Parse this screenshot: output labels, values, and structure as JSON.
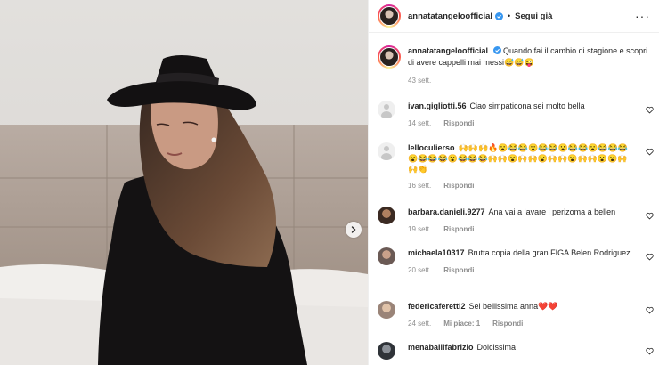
{
  "post": {
    "username": "annatatangeloofficial",
    "follow_label": "Segui già",
    "dot": "•",
    "more": "···",
    "caption": "Quando fai il cambio di stagione e scopri di avere cappelli mai messi😅😅😜",
    "caption_time": "43 sett."
  },
  "comments": [
    {
      "user": "ivan.gigliotti.56",
      "text": "Ciao simpaticona sei molto bella",
      "time": "14 sett.",
      "reply": "Rispondi",
      "likes": ""
    },
    {
      "user": "lelloculierso",
      "text": "🙌🙌🙌🔥😮😂😂😮😂😂😮😂😂😮😂😂😂😮😂😂😂😮😂😂😂🙌🙌😮🙌🙌😮🙌🙌😮🙌🙌😮😮🙌🙌👏",
      "time": "16 sett.",
      "reply": "Rispondi",
      "likes": ""
    },
    {
      "user": "barbara.danieli.9277",
      "text": "Ana vai a lavare i perizoma a bellen",
      "time": "19 sett.",
      "reply": "Rispondi",
      "likes": ""
    },
    {
      "user": "michaela10317",
      "text": "Brutta copia della gran FIGA Belen Rodriguez",
      "time": "20 sett.",
      "reply": "Rispondi",
      "likes": ""
    },
    {
      "user": "federicaferetti2",
      "text": "Sei bellissima anna❤️❤️",
      "time": "24 sett.",
      "reply": "Rispondi",
      "likes": "Mi piace: 1"
    },
    {
      "user": "menaballifabrizio",
      "text": "Dolcissima",
      "time": "",
      "reply": "",
      "likes": ""
    }
  ],
  "colors": {
    "verified": "#3897f0",
    "muted": "#8e8e8e",
    "text": "#262626"
  }
}
